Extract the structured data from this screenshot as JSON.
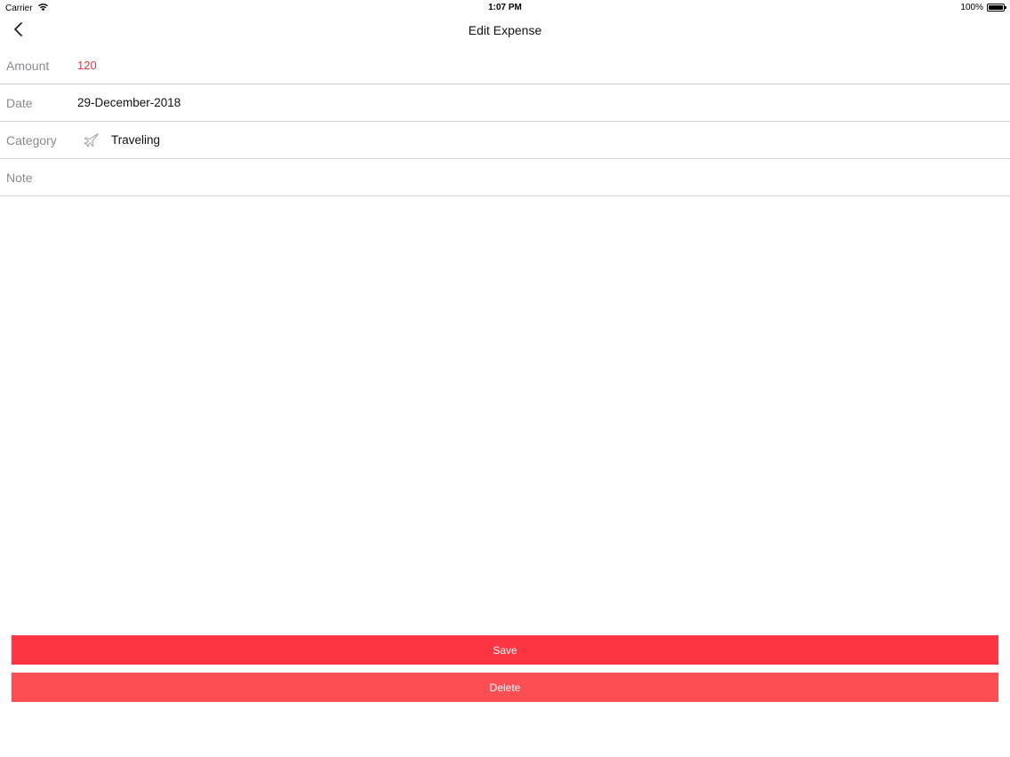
{
  "status_bar": {
    "carrier": "Carrier",
    "time": "1:07 PM",
    "battery": "100%",
    "battery_level": 1.0
  },
  "nav": {
    "back_icon": "chevron-left-icon",
    "title": "Edit Expense"
  },
  "form": {
    "amount": {
      "label": "Amount",
      "value": "120"
    },
    "date": {
      "label": "Date",
      "value": "29-December-2018"
    },
    "category": {
      "label": "Category",
      "icon": "airplane-icon",
      "value": "Traveling"
    },
    "note": {
      "label": "Note",
      "value": ""
    }
  },
  "actions": {
    "save_label": "Save",
    "delete_label": "Delete"
  },
  "colors": {
    "accent": "#fd3441",
    "delete": "#fd4e53",
    "amount_text": "#f2323f"
  }
}
